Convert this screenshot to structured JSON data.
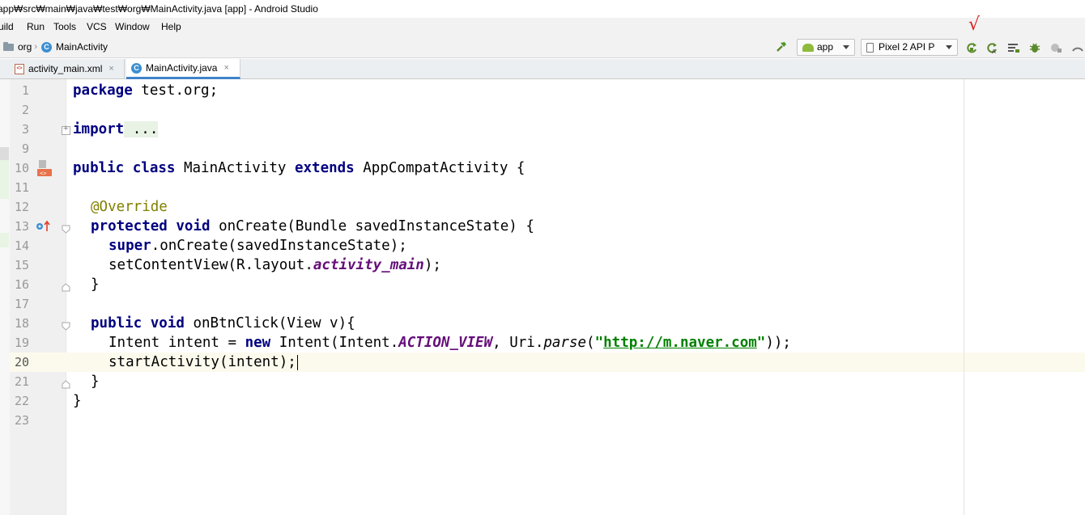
{
  "window": {
    "title": "app₩src₩main₩java₩test₩org₩MainActivity.java [app] - Android Studio"
  },
  "menu": {
    "items": [
      "uild",
      "Run",
      "Tools",
      "VCS",
      "Window",
      "Help"
    ]
  },
  "nav": {
    "crumbs": [
      "org",
      "MainActivity"
    ],
    "run_config": "app",
    "device": "Pixel 2 API P"
  },
  "toolbar": {
    "icons": [
      "build-hammer-icon",
      "apply-changes-icon",
      "apply-code-changes-icon",
      "sync-icon",
      "debug-bug-icon",
      "profile-icon",
      "stop-icon"
    ],
    "annotation_mark": "√"
  },
  "tabs": [
    {
      "label": "activity_main.xml",
      "active": false
    },
    {
      "label": "MainActivity.java",
      "active": true
    }
  ],
  "editor": {
    "current_line": "20",
    "lines": [
      {
        "num": "1"
      },
      {
        "num": "2"
      },
      {
        "num": "3"
      },
      {
        "num": "9"
      },
      {
        "num": "10"
      },
      {
        "num": "11"
      },
      {
        "num": "12"
      },
      {
        "num": "13"
      },
      {
        "num": "14"
      },
      {
        "num": "15"
      },
      {
        "num": "16"
      },
      {
        "num": "17"
      },
      {
        "num": "18"
      },
      {
        "num": "19"
      },
      {
        "num": "20"
      },
      {
        "num": "21"
      },
      {
        "num": "22"
      },
      {
        "num": "23"
      }
    ],
    "tokens": {
      "l1_kw": "package",
      "l1_rest": " test.org;",
      "l3_kw": "import",
      "l3_fold": " ...",
      "l10_kw1": "public",
      "l10_kw2": "class",
      "l10_name": " MainActivity ",
      "l10_kw3": "extends",
      "l10_rest": " AppCompatActivity {",
      "l12_ann": "@Override",
      "l13_kw1": "protected",
      "l13_kw2": "void",
      "l13_rest": " onCreate(Bundle savedInstanceState) {",
      "l14_kw": "super",
      "l14_rest": ".onCreate(savedInstanceState);",
      "l15_pre": "setContentView(R.layout.",
      "l15_fld": "activity_main",
      "l15_post": ");",
      "l16": "}",
      "l18_kw1": "public",
      "l18_kw2": "void",
      "l18_rest": " onBtnClick(View v){",
      "l19_pre": "Intent intent = ",
      "l19_kw": "new",
      "l19_mid1": " Intent(Intent.",
      "l19_fld": "ACTION_VIEW",
      "l19_mid2": ", Uri.",
      "l19_sm": "parse",
      "l19_paren": "(",
      "l19_q1": "\"",
      "l19_url": "http://m.naver.com",
      "l19_q2": "\"",
      "l19_end": "));",
      "l20": "startActivity(intent);",
      "l21": "}",
      "l22": "}"
    }
  },
  "colors": {
    "keyword": "#000080",
    "annotation": "#808000",
    "field": "#660e7a",
    "string": "#008000",
    "accent_tab": "#4083c9",
    "check_mark": "#e02020"
  }
}
